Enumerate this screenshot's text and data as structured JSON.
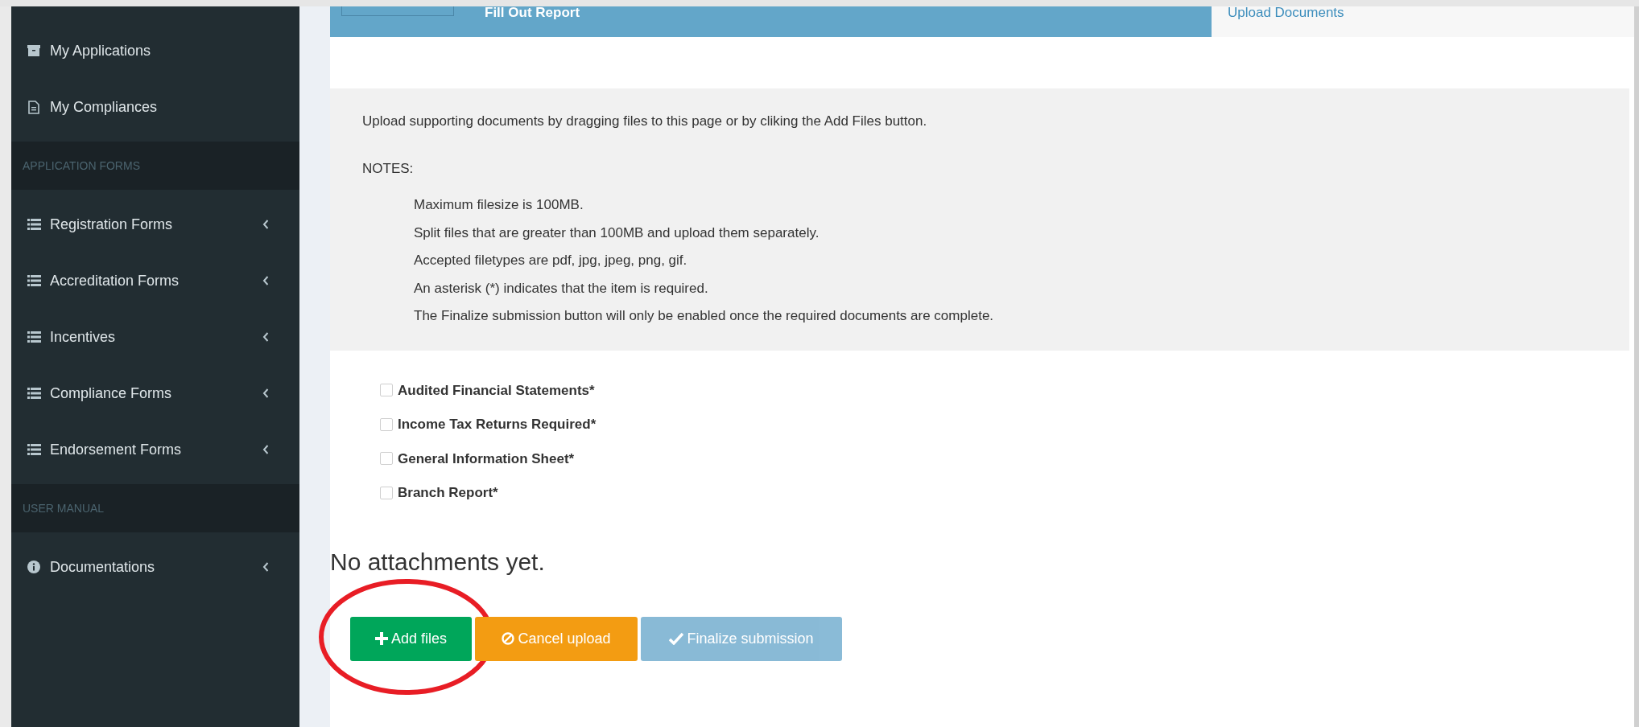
{
  "sidebar": {
    "items": [
      {
        "kind": "archive",
        "label": "My Applications",
        "expandable": false
      },
      {
        "kind": "document",
        "label": "My Compliances",
        "expandable": false
      },
      {
        "kind": "header",
        "label": "APPLICATION FORMS"
      },
      {
        "kind": "list",
        "label": "Registration Forms",
        "expandable": true
      },
      {
        "kind": "list",
        "label": "Accreditation Forms",
        "expandable": true
      },
      {
        "kind": "list",
        "label": "Incentives",
        "expandable": true
      },
      {
        "kind": "list",
        "label": "Compliance Forms",
        "expandable": true
      },
      {
        "kind": "list",
        "label": "Endorsement Forms",
        "expandable": true
      },
      {
        "kind": "header",
        "label": "USER MANUAL"
      },
      {
        "kind": "info",
        "label": "Documentations",
        "expandable": true
      }
    ]
  },
  "steps": [
    {
      "label": "Fill Out Report",
      "selected": true
    },
    {
      "label": "Upload Documents",
      "selected": false
    }
  ],
  "notes_panel": {
    "intro": "Upload supporting documents by dragging files to this page or by cliking the Add Files button.",
    "heading": "NOTES:",
    "lines": [
      "Maximum filesize is 100MB.",
      "Split files that are greater than 100MB and upload them separately.",
      "Accepted filetypes are pdf, jpg, jpeg, png, gif.",
      "An asterisk (*) indicates that the item is required.",
      "The Finalize submission button will only be enabled once the required documents are complete."
    ]
  },
  "requirements": [
    {
      "label": "Audited Financial Statements*",
      "checked": false
    },
    {
      "label": "Income Tax Returns Required*",
      "checked": false
    },
    {
      "label": "General Information Sheet*",
      "checked": false
    },
    {
      "label": "Branch Report*",
      "checked": false
    }
  ],
  "attachments_message": "No attachments yet.",
  "buttons": [
    {
      "kind": "add",
      "label": "Add files",
      "disabled": false,
      "circled": true
    },
    {
      "kind": "cancel",
      "label": "Cancel upload",
      "disabled": false,
      "circled": false
    },
    {
      "kind": "finalize",
      "label": "Finalize submission",
      "disabled": true,
      "circled": false
    }
  ]
}
